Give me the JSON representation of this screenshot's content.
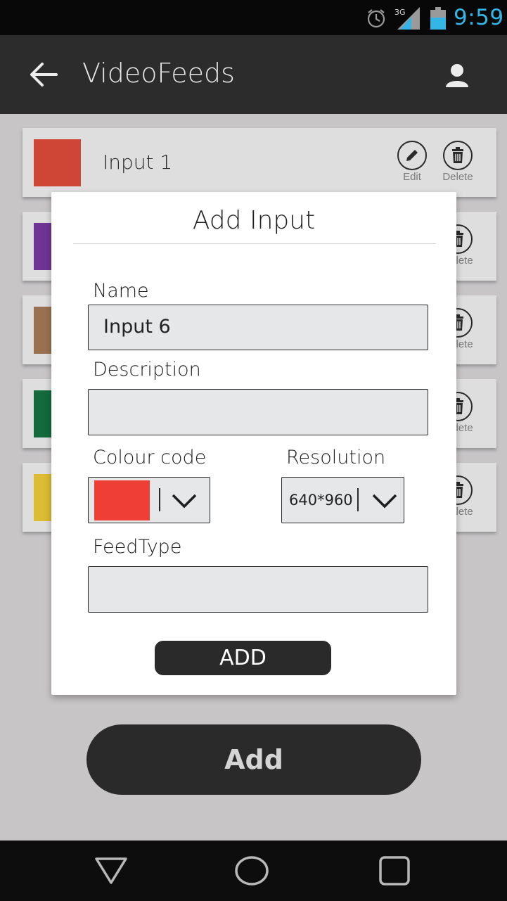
{
  "status_bar": {
    "time": "9:59",
    "network": "3G",
    "icons": [
      "alarm-icon",
      "signal-3g-icon",
      "battery-icon"
    ],
    "time_color": "#33b5e5"
  },
  "app_bar": {
    "title": "VideoFeeds",
    "icons": [
      "back-arrow-icon",
      "user-icon"
    ]
  },
  "inputs": [
    {
      "label": "Input 1",
      "color": "#cf4536",
      "edit_label": "Edit",
      "delete_label": "Delete"
    },
    {
      "label": "",
      "color": "#6f3595",
      "edit_label": "",
      "delete_label": "Delete"
    },
    {
      "label": "",
      "color": "#9a7150",
      "edit_label": "",
      "delete_label": "Delete"
    },
    {
      "label": "",
      "color": "#136a3d",
      "edit_label": "",
      "delete_label": "Delete"
    },
    {
      "label": "",
      "color": "#dcbc33",
      "edit_label": "",
      "delete_label": "Delete"
    }
  ],
  "main": {
    "add_label": "Add"
  },
  "dialog": {
    "title": "Add Input",
    "name_label": "Name",
    "name_value": "Input 6",
    "description_label": "Description",
    "description_value": "",
    "colour_label": "Colour code",
    "colour_value": "#ee3e36",
    "resolution_label": "Resolution",
    "resolution_value": "640*960",
    "feedtype_label": "FeedType",
    "feedtype_value": "",
    "add_label": "ADD"
  },
  "nav_bar": {
    "icons": [
      "back-triangle-icon",
      "home-circle-icon",
      "recents-square-icon"
    ]
  }
}
